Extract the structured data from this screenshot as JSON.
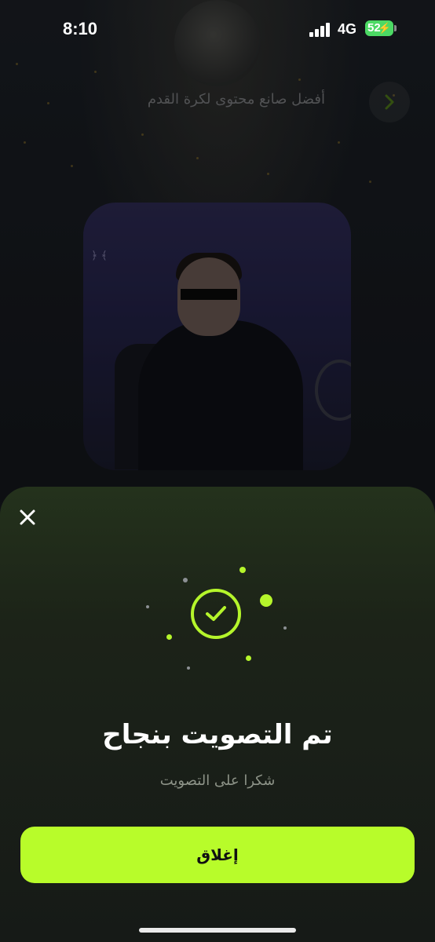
{
  "status_bar": {
    "time": "8:10",
    "network": "4G",
    "battery": "52"
  },
  "header": {
    "title": "أفضل صانع محتوى لكرة القدم"
  },
  "sheet": {
    "title": "تم التصويت بنجاح",
    "subtitle": "شكرا على التصويت",
    "close_button_label": "إغلاق"
  },
  "icons": {
    "back": "chevron-icon",
    "close": "close-icon",
    "success": "check-circle-icon"
  },
  "colors": {
    "accent": "#b8fc2a",
    "battery": "#4cd964",
    "sheet_bg": "#1c2318"
  }
}
